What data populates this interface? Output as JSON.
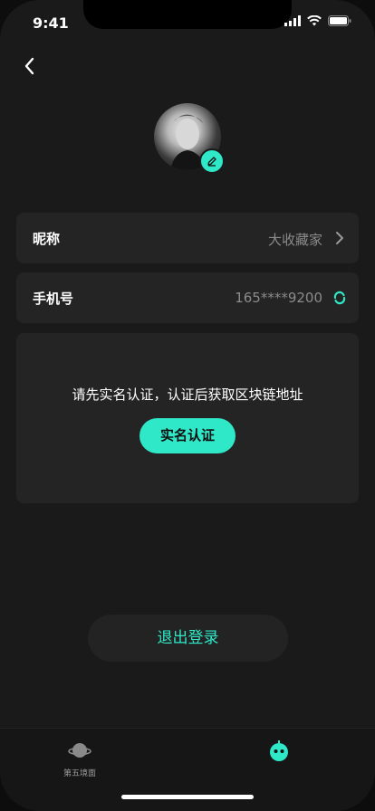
{
  "status": {
    "time": "9:41"
  },
  "profile": {
    "nickname_label": "昵称",
    "nickname_value": "大收藏家",
    "phone_label": "手机号",
    "phone_value": "165****9200"
  },
  "verification": {
    "notice": "请先实名认证，认证后获取区块链地址",
    "button_label": "实名认证"
  },
  "logout_label": "退出登录",
  "tabs": [
    {
      "label": "第五境面",
      "icon": "planet-icon"
    },
    {
      "label": "",
      "icon": "robot-icon"
    }
  ],
  "colors": {
    "accent": "#2ee8c8",
    "background": "#1a1a1a",
    "card": "#242424"
  }
}
